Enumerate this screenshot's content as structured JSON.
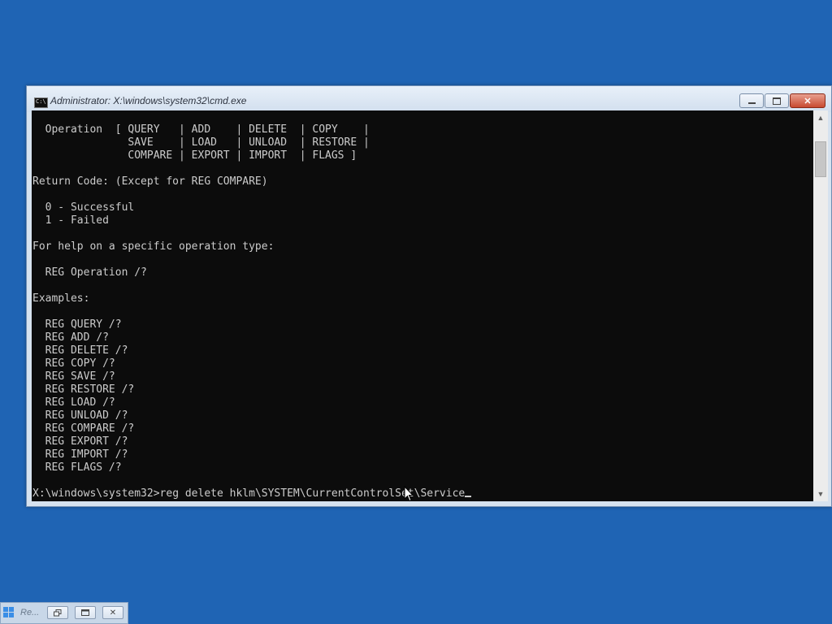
{
  "window": {
    "title": "Administrator: X:\\windows\\system32\\cmd.exe",
    "icon": "cmd-icon",
    "icon_glyph": "C:\\"
  },
  "caption_buttons": {
    "minimize_icon": "minimize-icon",
    "maximize_icon": "maximize-icon",
    "close_icon": "close-icon",
    "close_glyph": "✕"
  },
  "console": {
    "lines": [
      "  Operation  [ QUERY   | ADD    | DELETE  | COPY    |",
      "               SAVE    | LOAD   | UNLOAD  | RESTORE |",
      "               COMPARE | EXPORT | IMPORT  | FLAGS ]",
      "",
      "Return Code: (Except for REG COMPARE)",
      "",
      "  0 - Successful",
      "  1 - Failed",
      "",
      "For help on a specific operation type:",
      "",
      "  REG Operation /?",
      "",
      "Examples:",
      "",
      "  REG QUERY /?",
      "  REG ADD /?",
      "  REG DELETE /?",
      "  REG COPY /?",
      "  REG SAVE /?",
      "  REG RESTORE /?",
      "  REG LOAD /?",
      "  REG UNLOAD /?",
      "  REG COMPARE /?",
      "  REG EXPORT /?",
      "  REG IMPORT /?",
      "  REG FLAGS /?"
    ],
    "prompt": "X:\\windows\\system32>",
    "command_input": "reg delete hklm\\SYSTEM\\CurrentControlSet\\Service"
  },
  "scrollbar": {
    "up_glyph": "▲",
    "down_glyph": "▼"
  },
  "taskbar_stub": {
    "label": "Re...",
    "icon": "setup-icon",
    "close_glyph": "✕"
  },
  "colors": {
    "desktop": "#1f64b4",
    "console_bg": "#0c0c0c",
    "console_fg": "#cccccc"
  }
}
